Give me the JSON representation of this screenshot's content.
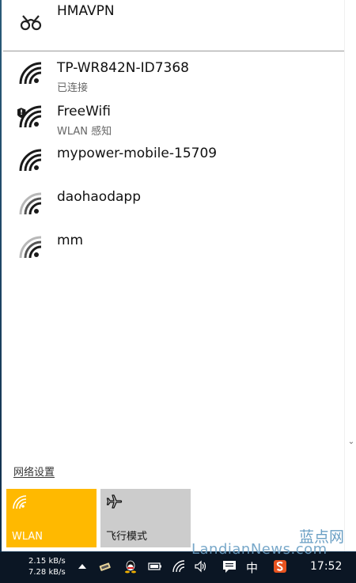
{
  "vpn": {
    "name": "HMAVPN",
    "icon": "vpn-icon"
  },
  "networks": [
    {
      "ssid": "TP-WR842N-ID7368",
      "status": "已连接",
      "icon": "wifi-signal-icon",
      "secured": false
    },
    {
      "ssid": "FreeWifi",
      "status": "WLAN 感知",
      "icon": "wifi-shield-icon",
      "secured": true
    },
    {
      "ssid": "mypower-mobile-15709",
      "status": "",
      "icon": "wifi-signal-icon",
      "secured": false
    },
    {
      "ssid": "daohaodapp",
      "status": "",
      "icon": "wifi-weak-icon",
      "secured": false
    },
    {
      "ssid": "mm",
      "status": "",
      "icon": "wifi-weak-icon",
      "secured": false
    }
  ],
  "settings_link": "网络设置",
  "quick_actions": [
    {
      "label": "WLAN",
      "state": "on",
      "icon": "wifi-icon",
      "color": "#ffb900"
    },
    {
      "label": "飞行模式",
      "state": "off",
      "icon": "airplane-icon",
      "color": "#cccccc"
    }
  ],
  "taskbar": {
    "upload_speed": "2.15 kB/s",
    "download_speed": "7.28 kB/s",
    "ime": "中",
    "clock": "17:52"
  },
  "watermark": {
    "cn": "蓝点网",
    "en": "LandianNews.com"
  }
}
